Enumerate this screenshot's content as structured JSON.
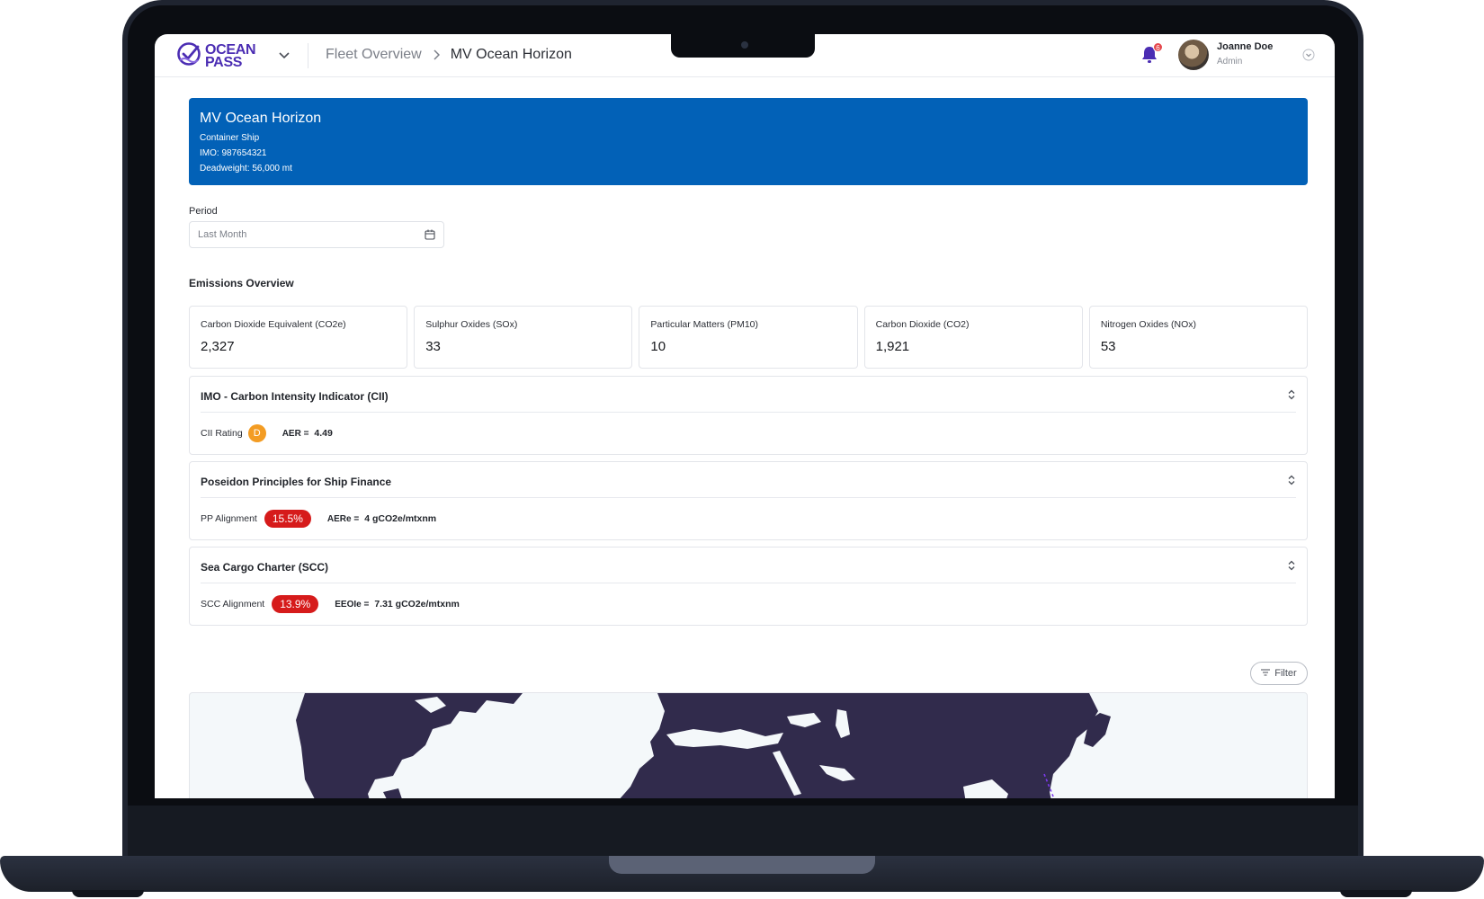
{
  "app": {
    "logo_line1": "OCEAN",
    "logo_line2": "PASS",
    "brand_color": "#4b2db3"
  },
  "breadcrumb": {
    "parent": "Fleet Overview",
    "current": "MV Ocean Horizon"
  },
  "user": {
    "name": "Joanne Doe",
    "role": "Admin",
    "notification_count": "6"
  },
  "vessel": {
    "name": "MV Ocean Horizon",
    "type": "Container Ship",
    "imo": "IMO: 987654321",
    "deadweight": "Deadweight: 56,000 mt",
    "banner_color": "#0261b7"
  },
  "period": {
    "label": "Period",
    "placeholder": "Last Month"
  },
  "emissions": {
    "title": "Emissions Overview",
    "cards": [
      {
        "label": "Carbon Dioxide Equivalent (CO2e)",
        "value": "2,327"
      },
      {
        "label": "Sulphur Oxides (SOx)",
        "value": "33"
      },
      {
        "label": "Particular Matters (PM10)",
        "value": "10"
      },
      {
        "label": "Carbon Dioxide  (CO2)",
        "value": "1,921"
      },
      {
        "label": "Nitrogen Oxides (NOx)",
        "value": "53"
      }
    ]
  },
  "cii": {
    "title": "IMO - Carbon Intensity Indicator (CII)",
    "rating_label": "CII Rating",
    "rating": "D",
    "rating_color": "#f39c23",
    "metric_label": "AER =",
    "metric_value": "4.49"
  },
  "poseidon": {
    "title": "Poseidon Principles for Ship Finance",
    "alignment_label": "PP Alignment",
    "alignment_value": "15.5%",
    "metric_label": "AERe =",
    "metric_value": "4 gCO2e/mtxnm"
  },
  "scc": {
    "title": "Sea Cargo Charter (SCC)",
    "alignment_label": "SCC Alignment",
    "alignment_value": "13.9%",
    "metric_label": "EEOIe =",
    "metric_value": "7.31 gCO2e/mtxnm"
  },
  "alert_color": "#d61b1b",
  "filter": {
    "label": "Filter"
  },
  "map": {
    "land_color": "#312b4c",
    "sea_color": "#f4f8fa"
  }
}
